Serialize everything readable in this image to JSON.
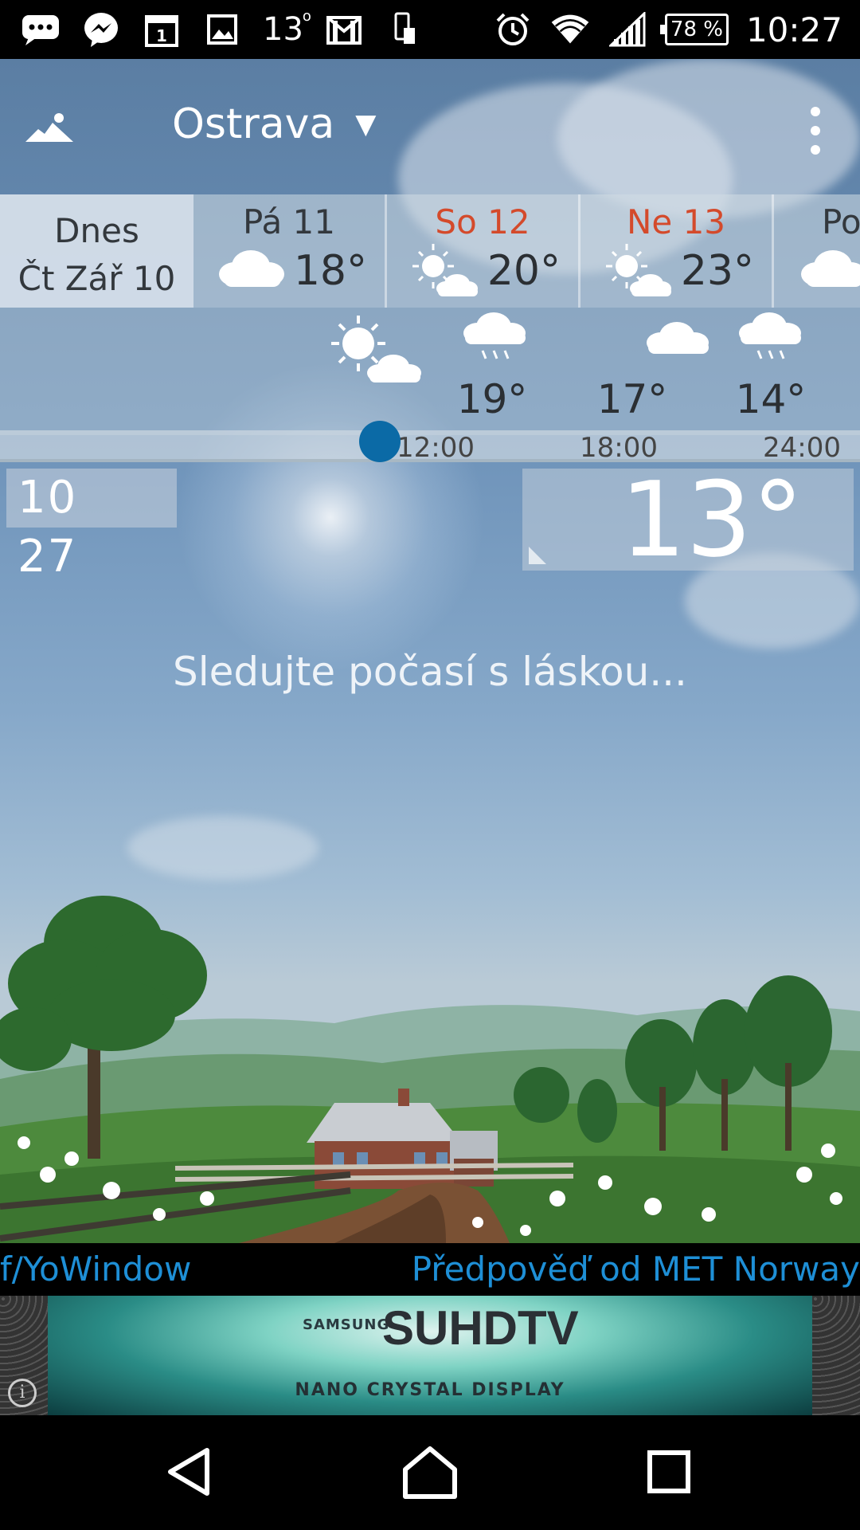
{
  "status_bar": {
    "icons": [
      "chat-bubble-icon",
      "messenger-icon",
      "calendar-icon",
      "gallery-icon",
      "weather-temp",
      "gmail-icon",
      "phone-sim-icon"
    ],
    "calendar_day": "1",
    "weather_temp": "13",
    "battery": "78 %",
    "time": "10:27"
  },
  "header": {
    "city": "Ostrava",
    "dropdown_symbol": "▼"
  },
  "days": {
    "today": {
      "line1": "Dnes",
      "line2": "Čt Zář 10"
    },
    "items": [
      {
        "name": "Pá 11",
        "temp": "18°",
        "icon": "cloud-icon",
        "weekend": false
      },
      {
        "name": "So 12",
        "temp": "20°",
        "icon": "partly-sunny-icon",
        "weekend": true
      },
      {
        "name": "Ne 13",
        "temp": "23°",
        "icon": "partly-sunny-icon",
        "weekend": true
      },
      {
        "name": "Po",
        "temp": "",
        "icon": "cloud-icon",
        "weekend": false
      }
    ]
  },
  "hourly": {
    "items": [
      {
        "icon": "partly-sunny-icon",
        "temp": ""
      },
      {
        "icon": "rain-icon",
        "temp": "19°"
      },
      {
        "icon": "cloud-icon",
        "temp": "17°"
      },
      {
        "icon": "rain-icon",
        "temp": "14°"
      }
    ],
    "times": [
      "12:00",
      "18:00",
      "24:00"
    ]
  },
  "current": {
    "hour": "10",
    "minute": "27",
    "temperature": "13°"
  },
  "slogan": "Sledujte počasí s láskou...",
  "footer": {
    "left_link": "f/YoWindow",
    "right_link": "Předpověď od MET Norway"
  },
  "ad": {
    "brand": "SAMSUNG",
    "product": "SUHDTV",
    "tagline": "NANO CRYSTAL DISPLAY",
    "info": "i"
  },
  "colors": {
    "accent": "#0b6aa6",
    "weekend": "#d44a2b",
    "link": "#1e8fd6"
  }
}
